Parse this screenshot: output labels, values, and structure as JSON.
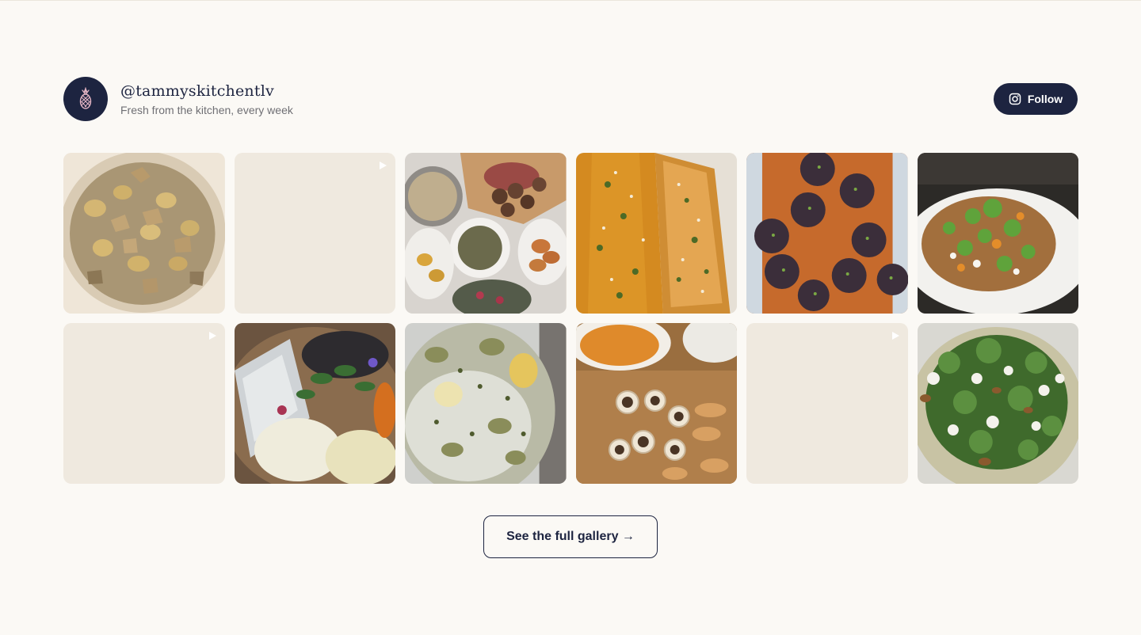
{
  "profile": {
    "handle": "@tammyskitchentlv",
    "tagline": "Fresh from the kitchen, every week",
    "avatar_icon": "pineapple-icon"
  },
  "follow_button": {
    "label": "Follow",
    "icon": "instagram-icon"
  },
  "colors": {
    "navy": "#1d2440",
    "background": "#fbf9f5",
    "placeholder": "#efe9df",
    "accent_pink": "#e7b7c6"
  },
  "tiles": [
    {
      "name": "tile-truffle-gnocchi",
      "kind": "photo",
      "alt": "truffle gnocchi"
    },
    {
      "name": "tile-video-1",
      "kind": "video"
    },
    {
      "name": "tile-meat-spread",
      "kind": "photo",
      "alt": "meat spread table"
    },
    {
      "name": "tile-sesame-squash",
      "kind": "photo",
      "alt": "sesame squash"
    },
    {
      "name": "tile-black-kibbeh",
      "kind": "photo",
      "alt": "black kibbeh balls"
    },
    {
      "name": "tile-herb-salad",
      "kind": "photo",
      "alt": "herb salad plate"
    },
    {
      "name": "tile-video-2",
      "kind": "video"
    },
    {
      "name": "tile-cheese-board",
      "kind": "photo",
      "alt": "cheese board"
    },
    {
      "name": "tile-artichoke-fish",
      "kind": "photo",
      "alt": "artichoke fish"
    },
    {
      "name": "tile-bone-marrow",
      "kind": "photo",
      "alt": "bone marrow board"
    },
    {
      "name": "tile-video-3",
      "kind": "video"
    },
    {
      "name": "tile-carpaccio",
      "kind": "photo",
      "alt": "greens carpaccio"
    }
  ],
  "gallery_button": {
    "label": "See the full gallery →"
  }
}
